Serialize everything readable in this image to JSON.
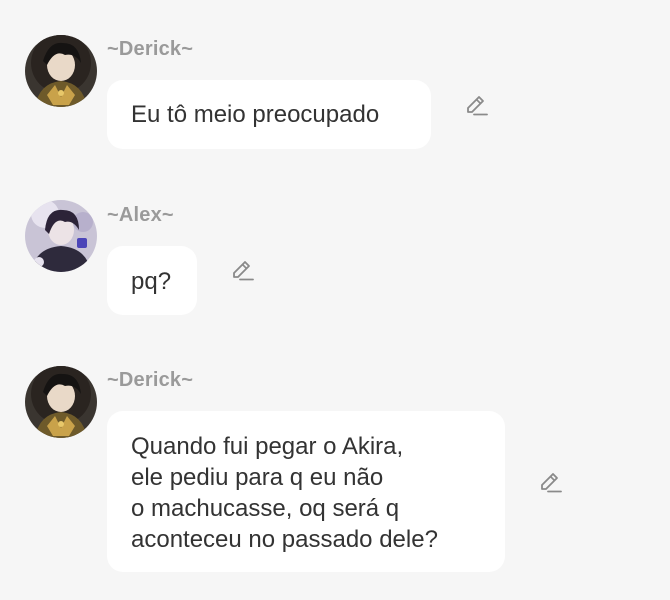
{
  "messages": [
    {
      "author": "~Derick~",
      "lines": [
        "Eu tô meio preocupado"
      ],
      "avatar_icon": "user-avatar-dark-hair-gold-outfit",
      "action_icon": "pencil-edit-icon"
    },
    {
      "author": "~Alex~",
      "lines": [
        "pq?"
      ],
      "avatar_icon": "user-avatar-dark-purple-hair",
      "action_icon": "pencil-edit-icon"
    },
    {
      "author": "~Derick~",
      "lines": [
        "Quando fui pegar o Akira,",
        "ele pediu para q eu não",
        "o machucasse, oq será q",
        "aconteceu no passado dele?"
      ],
      "avatar_icon": "user-avatar-dark-hair-gold-outfit",
      "action_icon": "pencil-edit-icon"
    }
  ],
  "colors": {
    "background": "#f6f6f6",
    "bubble": "#ffffff",
    "author_text": "#9a9a9a",
    "message_text": "#333333",
    "icon": "#8a8a8a"
  }
}
